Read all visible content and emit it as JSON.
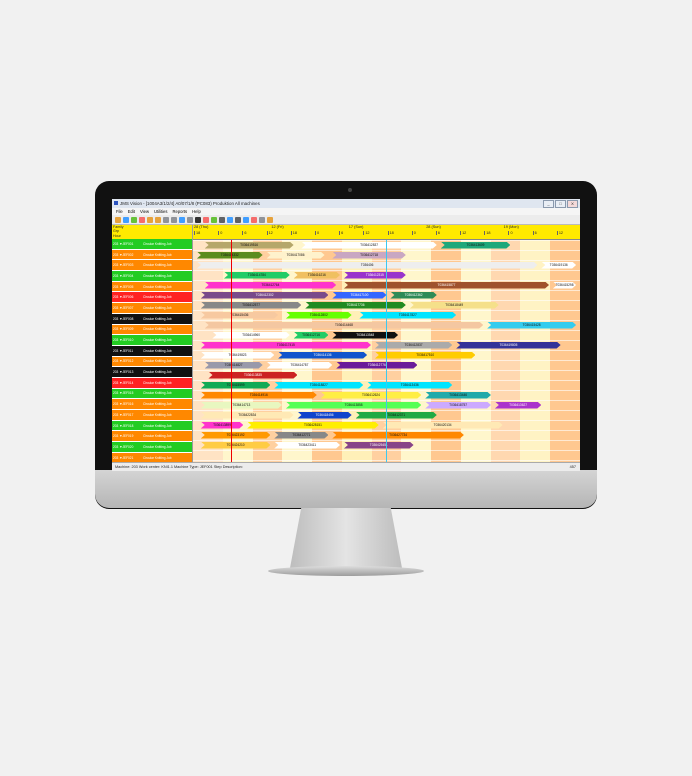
{
  "window": {
    "title": "JMS Vision - [1004A3/1/2/4] A0/07/1/8 (PC083) Produktion All machines",
    "buttons": [
      "_",
      "□",
      "X"
    ]
  },
  "menu": [
    "File",
    "Edit",
    "View",
    "Utilities",
    "Reports",
    "Help"
  ],
  "toolbar_icons": [
    "open-icon",
    "save-icon",
    "mail-icon",
    "clock-icon",
    "arrow-left-icon",
    "arrow-right-icon",
    "zoom-in-icon",
    "zoom-out-icon",
    "filter-icon",
    "dropdown-icon",
    "truck-icon",
    "calendar-icon",
    "grid-icon",
    "print-icon",
    "preview-icon",
    "eye-icon",
    "link-icon",
    "chart-icon",
    "settings-icon",
    "help-icon"
  ],
  "left_header": [
    "Family",
    "Grp",
    "Hour"
  ],
  "machines": [
    {
      "name": "203 ▼JEF001",
      "job": "Circular Knitting Job",
      "color": "#22cc22"
    },
    {
      "name": "203 ▼JEF002",
      "job": "Circular Knitting Job",
      "color": "#ff8800"
    },
    {
      "name": "203 ▼JEF003",
      "job": "Circular Knitting Job",
      "color": "#ff8800"
    },
    {
      "name": "203 ▼JEF004",
      "job": "Circular Knitting Job",
      "color": "#22cc22"
    },
    {
      "name": "203 ▼JEF005",
      "job": "Circular Knitting Job",
      "color": "#ff8800"
    },
    {
      "name": "203 ▼JEF006",
      "job": "Circular Knitting Job",
      "color": "#ff2222"
    },
    {
      "name": "203 ▼JEF007",
      "job": "Circular Knitting Job",
      "color": "#ff8800"
    },
    {
      "name": "203 ▼JEF008",
      "job": "Circular Knitting Job",
      "color": "#111111"
    },
    {
      "name": "203 ▼JEF009",
      "job": "Circular Knitting Job",
      "color": "#ff8800"
    },
    {
      "name": "203 ▼JEF010",
      "job": "Circular Knitting Job",
      "color": "#22cc22"
    },
    {
      "name": "203 ▼JEF011",
      "job": "Circular Knitting Job",
      "color": "#111111"
    },
    {
      "name": "203 ▼JEF012",
      "job": "Circular Knitting Job",
      "color": "#ff8800"
    },
    {
      "name": "203 ▼JEF013",
      "job": "Circular Knitting Job",
      "color": "#111111"
    },
    {
      "name": "203 ▼JEF014",
      "job": "Circular Knitting Job",
      "color": "#ff2222"
    },
    {
      "name": "203 ▼JEF015",
      "job": "Circular Knitting Job",
      "color": "#22cc22"
    },
    {
      "name": "203 ▼JEF016",
      "job": "Circular Knitting Job",
      "color": "#ff8800"
    },
    {
      "name": "203 ▼JEF017",
      "job": "Circular Knitting Job",
      "color": "#ff8800"
    },
    {
      "name": "203 ▼JEF018",
      "job": "Circular Knitting Job",
      "color": "#22cc22"
    },
    {
      "name": "203 ▼JEF019",
      "job": "Circular Knitting Job",
      "color": "#ff8800"
    },
    {
      "name": "203 ▼JEF020",
      "job": "Circular Knitting Job",
      "color": "#22cc22"
    },
    {
      "name": "203 ▼JEF021",
      "job": "Circular Knitting Job",
      "color": "#ff8800"
    },
    {
      "name": "203 ▼JEF022",
      "job": "Circular Knitting Job",
      "color": "#22cc22"
    }
  ],
  "timescale": {
    "days": [
      "28 (Thu)",
      "12 (Fri)",
      "17 (Sun)",
      "28 (Sun)",
      "19 (Mon)"
    ],
    "hours": [
      "18",
      "0",
      "6",
      "12",
      "18",
      "0",
      "6",
      "12",
      "18",
      "0",
      "6",
      "12",
      "18",
      "0",
      "6",
      "12",
      "18"
    ]
  },
  "jobs": [
    {
      "row": 0,
      "start": 0.03,
      "end": 0.26,
      "color": "#b5a76a",
      "label": "T036419516"
    },
    {
      "row": 0,
      "start": 0.28,
      "end": 0.63,
      "color": "#ffffff",
      "label": "T036412837"
    },
    {
      "row": 0,
      "start": 0.64,
      "end": 0.82,
      "color": "#1ea87a",
      "label": "T036413609"
    },
    {
      "row": 1,
      "start": 0.01,
      "end": 0.18,
      "color": "#5b8c1e",
      "label": "T036414332"
    },
    {
      "row": 1,
      "start": 0.19,
      "end": 0.34,
      "color": "#fff2cc",
      "label": "T036417086"
    },
    {
      "row": 1,
      "start": 0.36,
      "end": 0.55,
      "color": "#c9a7c2",
      "label": "T036412718"
    },
    {
      "row": 2,
      "start": 0.01,
      "end": 0.89,
      "color": "#eeeeee",
      "label": "T036406"
    },
    {
      "row": 2,
      "start": 0.9,
      "end": 0.99,
      "color": "#ffffff",
      "label": "T036419136"
    },
    {
      "row": 3,
      "start": 0.08,
      "end": 0.25,
      "color": "#22cc66",
      "label": "T036414784"
    },
    {
      "row": 3,
      "start": 0.26,
      "end": 0.38,
      "color": "#f0c060",
      "label": "T036416216"
    },
    {
      "row": 3,
      "start": 0.39,
      "end": 0.55,
      "color": "#9933cc",
      "label": "T036412315"
    },
    {
      "row": 4,
      "start": 0.03,
      "end": 0.37,
      "color": "#ff33cc",
      "label": "T036412764"
    },
    {
      "row": 4,
      "start": 0.39,
      "end": 0.92,
      "color": "#a0522d",
      "label": "T036415877"
    },
    {
      "row": 4,
      "start": 0.93,
      "end": 0.99,
      "color": "#ffffff",
      "label": "T036415298"
    },
    {
      "row": 5,
      "start": 0.02,
      "end": 0.35,
      "color": "#7a4a8a",
      "label": "T036412302"
    },
    {
      "row": 5,
      "start": 0.36,
      "end": 0.5,
      "color": "#3366ff",
      "label": "T036417100"
    },
    {
      "row": 5,
      "start": 0.51,
      "end": 0.63,
      "color": "#2e8b57",
      "label": "T036412362"
    },
    {
      "row": 6,
      "start": 0.02,
      "end": 0.28,
      "color": "#888888",
      "label": "T036412577"
    },
    {
      "row": 6,
      "start": 0.29,
      "end": 0.55,
      "color": "#228b22",
      "label": "T036417736"
    },
    {
      "row": 6,
      "start": 0.56,
      "end": 0.79,
      "color": "#f5e08a",
      "label": "T036418449"
    },
    {
      "row": 7,
      "start": 0.02,
      "end": 0.22,
      "color": "#f7c9a0",
      "label": "T036415436"
    },
    {
      "row": 7,
      "start": 0.24,
      "end": 0.41,
      "color": "#66ff00",
      "label": "T036412802"
    },
    {
      "row": 7,
      "start": 0.43,
      "end": 0.68,
      "color": "#00e5ff",
      "label": "T036417827"
    },
    {
      "row": 8,
      "start": 0.03,
      "end": 0.75,
      "color": "#f4c7a1",
      "label": "T036414468"
    },
    {
      "row": 8,
      "start": 0.76,
      "end": 0.99,
      "color": "#33ccee",
      "label": "T036415428"
    },
    {
      "row": 9,
      "start": 0.05,
      "end": 0.25,
      "color": "#ffffff",
      "label": "T036414960"
    },
    {
      "row": 9,
      "start": 0.26,
      "end": 0.35,
      "color": "#22cc66",
      "label": "T036412716"
    },
    {
      "row": 9,
      "start": 0.36,
      "end": 0.53,
      "color": "#111111",
      "label": "T036413548"
    },
    {
      "row": 10,
      "start": 0.02,
      "end": 0.46,
      "color": "#ff33cc",
      "label": "T036417415"
    },
    {
      "row": 10,
      "start": 0.47,
      "end": 0.67,
      "color": "#aaaaaa",
      "label": "T036412837"
    },
    {
      "row": 10,
      "start": 0.68,
      "end": 0.95,
      "color": "#333399",
      "label": "T036419805"
    },
    {
      "row": 11,
      "start": 0.02,
      "end": 0.21,
      "color": "#ffffff",
      "label": "T036419823"
    },
    {
      "row": 11,
      "start": 0.22,
      "end": 0.45,
      "color": "#1155cc",
      "label": "T036414136"
    },
    {
      "row": 11,
      "start": 0.47,
      "end": 0.73,
      "color": "#ffcc00",
      "label": "T036417510"
    },
    {
      "row": 12,
      "start": 0.03,
      "end": 0.18,
      "color": "#9999aa",
      "label": "T036414827"
    },
    {
      "row": 12,
      "start": 0.19,
      "end": 0.36,
      "color": "#ffffff",
      "label": "T036414787"
    },
    {
      "row": 12,
      "start": 0.37,
      "end": 0.58,
      "color": "#6a1b9a",
      "label": "T036412776"
    },
    {
      "row": 13,
      "start": 0.04,
      "end": 0.27,
      "color": "#cc2222",
      "label": "T036413835"
    },
    {
      "row": 14,
      "start": 0.02,
      "end": 0.2,
      "color": "#11aa55",
      "label": "T036415599"
    },
    {
      "row": 14,
      "start": 0.21,
      "end": 0.44,
      "color": "#00e5ff",
      "label": "T036418827"
    },
    {
      "row": 14,
      "start": 0.45,
      "end": 0.67,
      "color": "#00e5ff",
      "label": "T036413436"
    },
    {
      "row": 15,
      "start": 0.02,
      "end": 0.32,
      "color": "#ff8800",
      "label": "T036414916"
    },
    {
      "row": 15,
      "start": 0.33,
      "end": 0.59,
      "color": "#ffee44",
      "label": "T036412624"
    },
    {
      "row": 15,
      "start": 0.6,
      "end": 0.77,
      "color": "#22aaaa",
      "label": "T036413446"
    },
    {
      "row": 16,
      "start": 0.02,
      "end": 0.23,
      "color": "#e8f7c0",
      "label": "T036414713"
    },
    {
      "row": 16,
      "start": 0.24,
      "end": 0.59,
      "color": "#55ff55",
      "label": "T036413858"
    },
    {
      "row": 16,
      "start": 0.6,
      "end": 0.77,
      "color": "#ccaaff",
      "label": "T036418757"
    },
    {
      "row": 16,
      "start": 0.78,
      "end": 0.9,
      "color": "#aa33cc",
      "label": "T036413627"
    },
    {
      "row": 17,
      "start": 0.02,
      "end": 0.26,
      "color": "#ffe9b5",
      "label": "T036422834"
    },
    {
      "row": 17,
      "start": 0.27,
      "end": 0.41,
      "color": "#1144cc",
      "label": "T036418456"
    },
    {
      "row": 17,
      "start": 0.42,
      "end": 0.63,
      "color": "#22aa44",
      "label": "T036412371"
    },
    {
      "row": 18,
      "start": 0.02,
      "end": 0.13,
      "color": "#ff33cc",
      "label": "T036413899"
    },
    {
      "row": 18,
      "start": 0.14,
      "end": 0.48,
      "color": "#ffee00",
      "label": "T036428151"
    },
    {
      "row": 18,
      "start": 0.49,
      "end": 0.8,
      "color": "#ffe9b5",
      "label": "T036420134"
    },
    {
      "row": 19,
      "start": 0.02,
      "end": 0.2,
      "color": "#ff9900",
      "label": "T036423192"
    },
    {
      "row": 19,
      "start": 0.21,
      "end": 0.35,
      "color": "#888888",
      "label": "T036412771"
    },
    {
      "row": 19,
      "start": 0.36,
      "end": 0.7,
      "color": "#ff8800",
      "label": "T036427734"
    },
    {
      "row": 20,
      "start": 0.02,
      "end": 0.2,
      "color": "#ffcc44",
      "label": "T036424210"
    },
    {
      "row": 20,
      "start": 0.21,
      "end": 0.38,
      "color": "#ffffff",
      "label": "T036423411"
    },
    {
      "row": 20,
      "start": 0.39,
      "end": 0.57,
      "color": "#884488",
      "label": "T036425451"
    }
  ],
  "status": {
    "left": "Machine: 203  Work center: KNI1.1  Machine Type: JEF001  Step Description:",
    "right": "457"
  }
}
